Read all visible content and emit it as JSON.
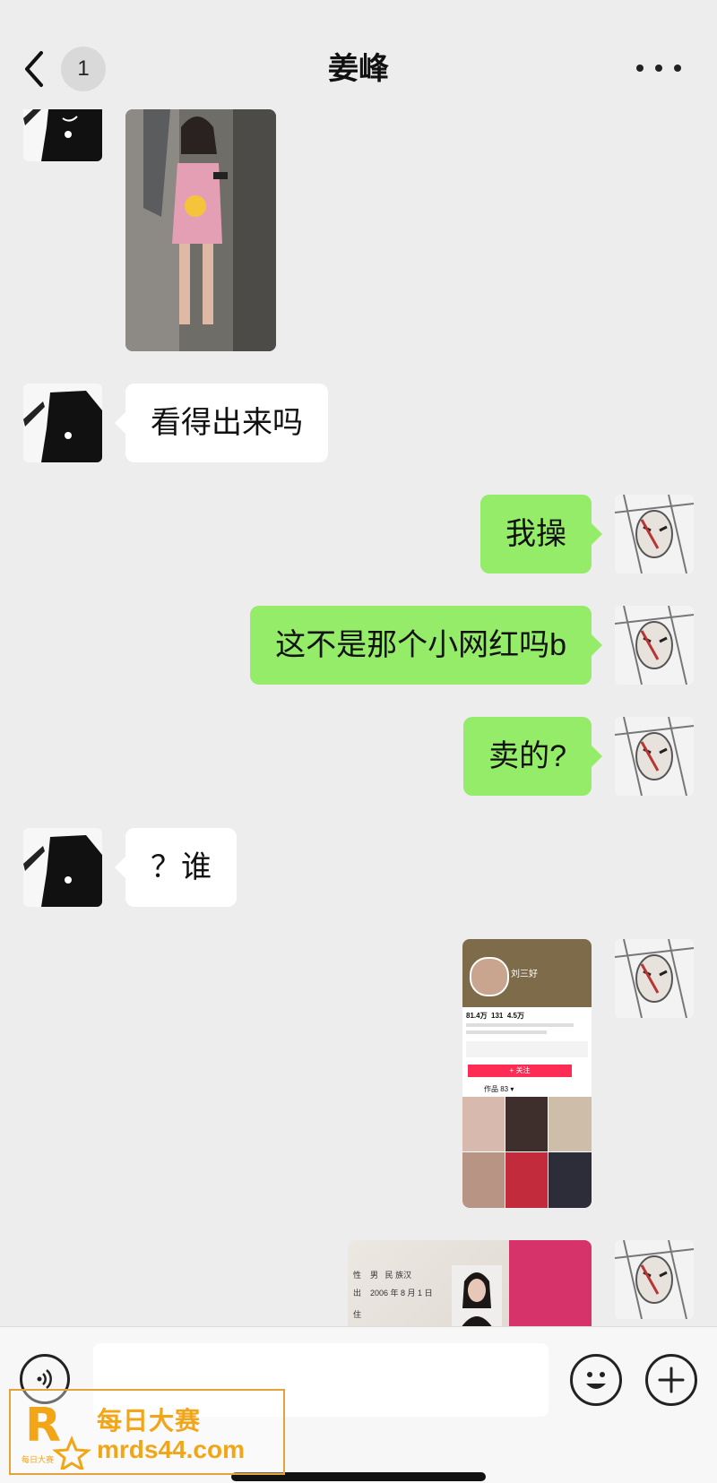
{
  "header": {
    "title": "姜峰",
    "unread_count": "1",
    "back_icon": "chevron-left-icon",
    "more_icon": "more-dots-icon"
  },
  "messages": [
    {
      "type": "image",
      "from": "contact",
      "description_icon": "photo"
    },
    {
      "type": "text",
      "from": "contact",
      "text": "看得出来吗"
    },
    {
      "type": "text",
      "from": "me",
      "text": "我操"
    },
    {
      "type": "text",
      "from": "me",
      "text": "这不是那个小网红吗b"
    },
    {
      "type": "text",
      "from": "me",
      "text": "卖的?"
    },
    {
      "type": "text",
      "from": "contact",
      "text": "？谁"
    },
    {
      "type": "image",
      "from": "me",
      "profile": {
        "name": "刘三好",
        "stat1": "81.4万",
        "stat2": "131",
        "stat3": "4.5万",
        "button": "+ 关注",
        "tab": "作品 83 ▾"
      }
    },
    {
      "type": "image",
      "from": "me",
      "id_card": {
        "row1_label": "性",
        "row1_value": "男",
        "row1_value2": "民 族汉",
        "row2_label": "出",
        "row2_value": "2006 年 8 月 1 日",
        "row3_label": "住"
      }
    }
  ],
  "input_bar": {
    "placeholder": "",
    "voice_icon": "voice-icon",
    "emoji_icon": "emoji-icon",
    "plus_icon": "plus-icon"
  },
  "watermark": {
    "line1": "每日大赛",
    "line2": "mrds44.com",
    "logo_letter": "R",
    "logo_small": "每日大赛"
  },
  "colors": {
    "background": "#ededed",
    "bubble_out": "#95ec69",
    "bubble_in": "#ffffff",
    "watermark": "#f2a516"
  }
}
